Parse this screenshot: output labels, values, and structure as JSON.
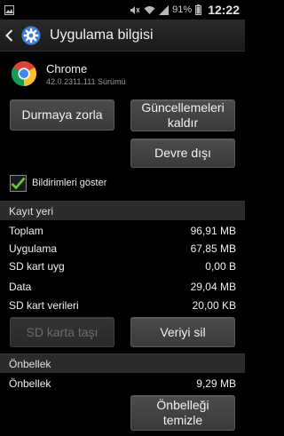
{
  "status_bar": {
    "battery_percent": "91%",
    "time": "12:22",
    "icons": [
      "image-icon",
      "mute-icon",
      "wifi-icon",
      "signal-icon",
      "battery-icon"
    ]
  },
  "title_bar": {
    "title": "Uygulama bilgisi",
    "icons": [
      "back-icon",
      "settings-gear-icon"
    ]
  },
  "app": {
    "name": "Chrome",
    "version": "42.0.2311.111 Sürümü",
    "icon": "chrome-icon"
  },
  "buttons": {
    "force_stop": "Durmaya zorla",
    "uninstall_updates": "Güncellemeleri kaldır",
    "disable": "Devre dışı",
    "move_to_sd": "SD karta taşı",
    "clear_data": "Veriyi sil",
    "clear_cache": "Önbelleği temizle"
  },
  "notifications": {
    "label": "Bildirimleri göster",
    "checked": true
  },
  "storage": {
    "header": "Kayıt yeri",
    "rows": [
      {
        "label": "Toplam",
        "value": "96,91 MB"
      },
      {
        "label": "Uygulama",
        "value": "67,85 MB"
      },
      {
        "label": "SD kart uyg",
        "value": "0,00 B"
      },
      {
        "label": "Data",
        "value": "29,04 MB"
      },
      {
        "label": "SD kart verileri",
        "value": "20,00 KB"
      }
    ]
  },
  "cache": {
    "header": "Önbellek",
    "rows": [
      {
        "label": "Önbellek",
        "value": "9,29 MB"
      }
    ]
  },
  "colors": {
    "accent_check": "#6ec23a",
    "background": "#000000",
    "section_bg": "#2b2b2b"
  }
}
